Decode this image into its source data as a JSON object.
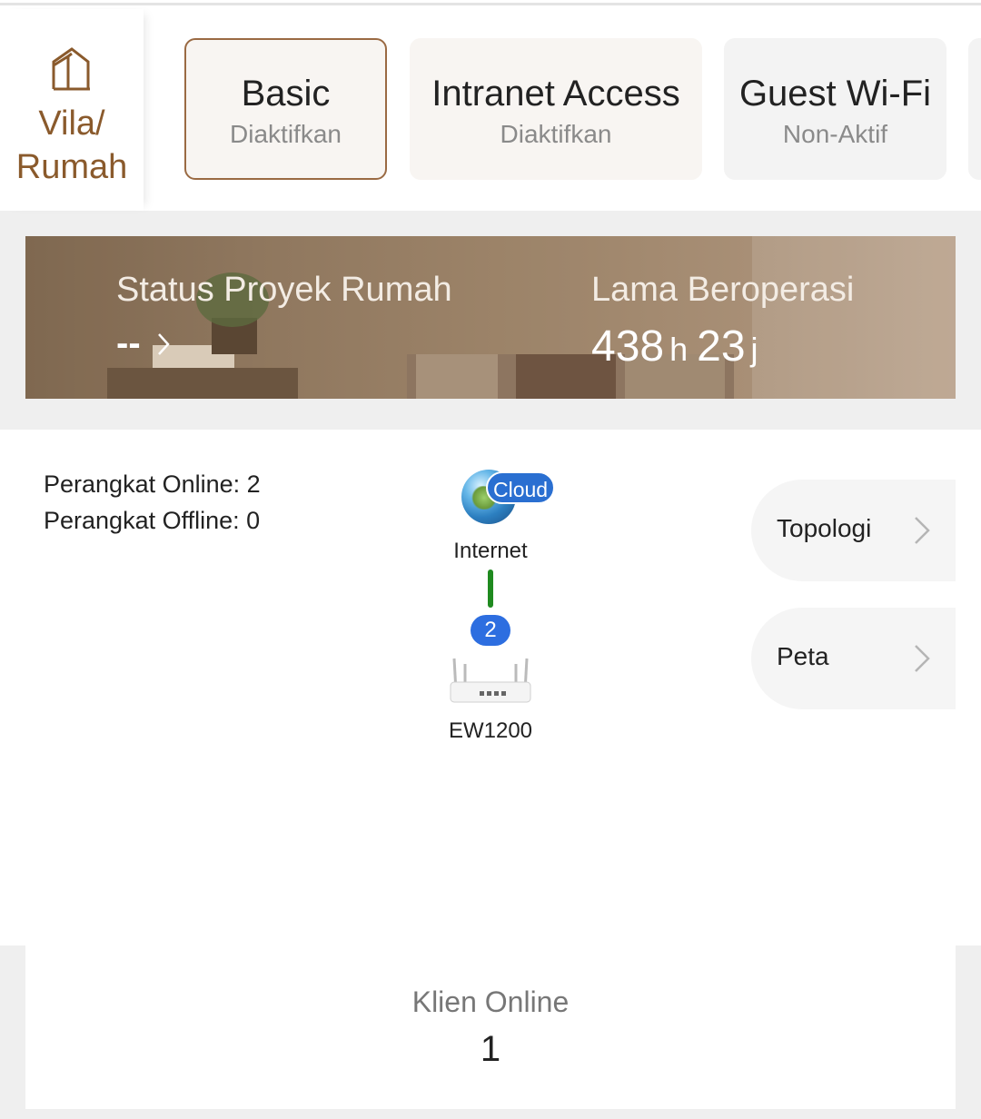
{
  "scene": {
    "label": "Vila/ Rumah",
    "icon": "house-icon"
  },
  "tabs": [
    {
      "title": "Basic",
      "status": "Diaktifkan",
      "selected": true
    },
    {
      "title": "Intranet Access",
      "status": "Diaktifkan"
    },
    {
      "title": "Guest Wi-Fi",
      "status": "Non-Aktif"
    }
  ],
  "banner": {
    "project_status_label": "Status Proyek Rumah",
    "project_status_value": "--",
    "uptime_label": "Lama Beroperasi",
    "uptime_hours": "438",
    "uptime_hours_unit": "h",
    "uptime_minutes": "23",
    "uptime_minutes_unit": "j"
  },
  "devices": {
    "online": "Perangkat Online: 2",
    "offline": "Perangkat Offline: 0"
  },
  "topology": {
    "cloud_badge": "Cloud",
    "internet_label": "Internet",
    "device_count": "2",
    "router_label": "EW1200",
    "link_color": "#1f8a1f"
  },
  "side_buttons": {
    "topology": "Topologi",
    "map": "Peta"
  },
  "clients": {
    "label": "Klien Online",
    "value": "1"
  },
  "colors": {
    "accent": "#8a5a2c",
    "badge_blue": "#2d6ee0"
  }
}
